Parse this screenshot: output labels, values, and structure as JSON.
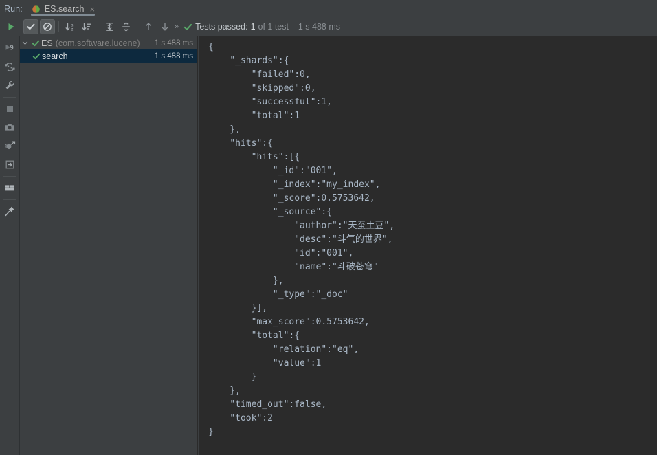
{
  "window": {
    "run_label": "Run:",
    "accent_green": "#499c54",
    "selected_row_bg": "#0d293e",
    "console_bg": "#2b2b2b",
    "panel_bg": "#3c3f41",
    "text_color": "#bbbbbb"
  },
  "tab": {
    "title": "ES.search",
    "close_label": "×",
    "icon": "run-configuration-icon",
    "active": true
  },
  "toolbar": {
    "buttons": [
      {
        "name": "rerun-tests-button",
        "icon": "play-icon",
        "toggled": false
      },
      {
        "name": "show-passed-button",
        "icon": "check-icon",
        "toggled": true
      },
      {
        "name": "show-ignored-button",
        "icon": "circle-slash-icon",
        "toggled": true
      },
      {
        "name": "sort-alphabetically-button",
        "icon": "sort-alpha-icon",
        "toggled": false
      },
      {
        "name": "sort-by-duration-button",
        "icon": "sort-duration-icon",
        "toggled": false
      },
      {
        "name": "expand-all-button",
        "icon": "expand-all-icon",
        "toggled": false
      },
      {
        "name": "collapse-all-button",
        "icon": "collapse-all-icon",
        "toggled": false
      },
      {
        "name": "previous-failed-button",
        "icon": "arrow-up-icon",
        "toggled": false
      },
      {
        "name": "next-failed-button",
        "icon": "arrow-down-icon",
        "toggled": false
      }
    ],
    "overflow_label": "»"
  },
  "status": {
    "icon": "check-icon",
    "passed_label": "Tests passed:",
    "passed_count": "1",
    "rest": "of 1 test – 1 s 488 ms"
  },
  "sidebar": {
    "items": [
      {
        "name": "rerun-failed-tests-button",
        "icon": "rerun-9-icon",
        "separator_after": false
      },
      {
        "name": "toggle-auto-test-button",
        "icon": "refresh-icon",
        "separator_after": false
      },
      {
        "name": "settings-button",
        "icon": "wrench-icon",
        "separator_after": true
      },
      {
        "name": "stop-button",
        "icon": "stop-square-icon",
        "separator_after": false
      },
      {
        "name": "soft-wrap-button",
        "icon": "camera-icon",
        "separator_after": false
      },
      {
        "name": "dump-threads-button",
        "icon": "bug-arrow-icon",
        "separator_after": false
      },
      {
        "name": "export-test-results-button",
        "icon": "export-icon",
        "separator_after": true
      },
      {
        "name": "layout-settings-button",
        "icon": "layout-grid-icon",
        "separator_after": true
      },
      {
        "name": "pin-tab-button",
        "icon": "pin-icon",
        "separator_after": false
      }
    ]
  },
  "test_tree": {
    "rows": [
      {
        "name": "ES",
        "package": "(com.software.lucene)",
        "duration": "1 s 488 ms",
        "indent": 1,
        "expanded": true,
        "has_arrow": true,
        "selected": false,
        "status": "passed"
      },
      {
        "name": "search",
        "package": "",
        "duration": "1 s 488 ms",
        "indent": 2,
        "expanded": false,
        "has_arrow": false,
        "selected": true,
        "status": "passed"
      }
    ]
  },
  "console": {
    "output": "{\n    \"_shards\":{\n        \"failed\":0,\n        \"skipped\":0,\n        \"successful\":1,\n        \"total\":1\n    },\n    \"hits\":{\n        \"hits\":[{\n            \"_id\":\"001\",\n            \"_index\":\"my_index\",\n            \"_score\":0.5753642,\n            \"_source\":{\n                \"author\":\"天蚕土豆\",\n                \"desc\":\"斗气的世界\",\n                \"id\":\"001\",\n                \"name\":\"斗破苍穹\"\n            },\n            \"_type\":\"_doc\"\n        }],\n        \"max_score\":0.5753642,\n        \"total\":{\n            \"relation\":\"eq\",\n            \"value\":1\n        }\n    },\n    \"timed_out\":false,\n    \"took\":2\n}"
  }
}
